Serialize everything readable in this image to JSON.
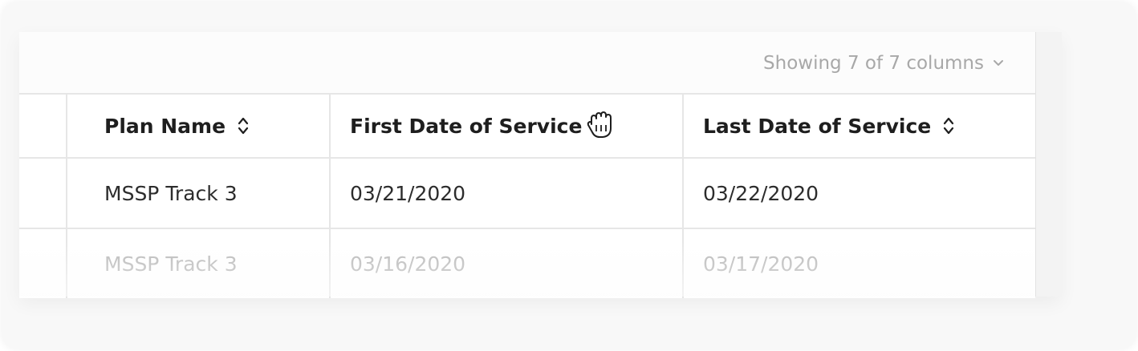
{
  "toolbar": {
    "columns_label": "Showing 7 of 7 columns"
  },
  "table": {
    "headers": [
      {
        "label": "Plan Name",
        "sortable": true
      },
      {
        "label": "First Date of Service",
        "sortable": false
      },
      {
        "label": "Last Date of Service",
        "sortable": true
      }
    ],
    "rows": [
      [
        "MSSP Track 3",
        "03/21/2020",
        "03/22/2020"
      ],
      [
        "MSSP Track 3",
        "03/16/2020",
        "03/17/2020"
      ]
    ]
  },
  "icons": {
    "sort": "sort-updown-icon",
    "cursor": "grab-hand-cursor-icon",
    "dropdown": "chevron-down-icon"
  },
  "colors": {
    "header_text": "#1e1e1e",
    "cell_text": "#2c2c2c",
    "faded_text": "#b9b9b9",
    "muted_text": "#a8a8a8",
    "grid_line": "#e6e6e6"
  }
}
